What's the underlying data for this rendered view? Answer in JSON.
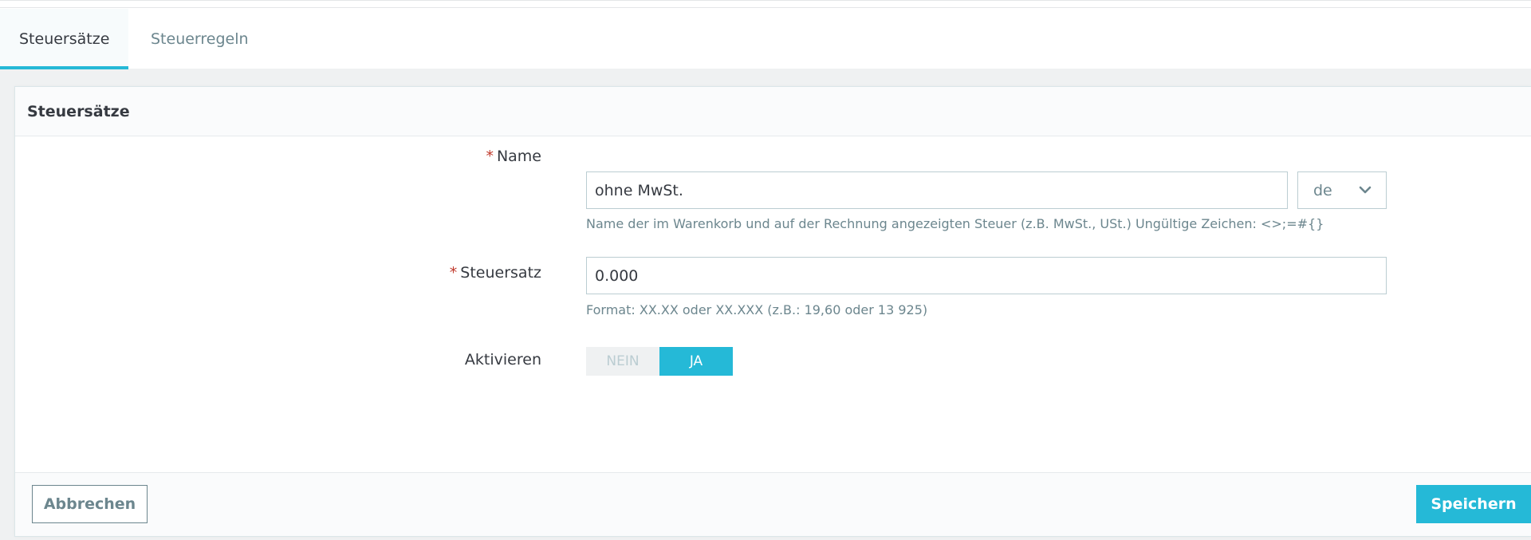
{
  "tabs": [
    {
      "label": "Steuersätze",
      "active": true
    },
    {
      "label": "Steuerregeln",
      "active": false
    }
  ],
  "panel": {
    "title": "Steuersätze"
  },
  "form": {
    "required_mark": "*",
    "name": {
      "label": "Name",
      "value": "ohne MwSt.",
      "language": "de",
      "help": "Name der im Warenkorb und auf der Rechnung angezeigten Steuer (z.B. MwSt., USt.) Ungültige Zeichen: <>;=#{}"
    },
    "rate": {
      "label": "Steuersatz",
      "value": "0.000",
      "help": "Format: XX.XX oder XX.XXX (z.B.: 19,60 oder 13 925)"
    },
    "active": {
      "label": "Aktivieren",
      "off_label": "NEIN",
      "on_label": "JA",
      "value": "JA"
    }
  },
  "footer": {
    "cancel_label": "Abbrechen",
    "save_label": "Speichern"
  },
  "colors": {
    "accent": "#25b9d7",
    "required": "#c0392b"
  },
  "icons": {
    "language_dropdown": "chevron-down-icon"
  }
}
